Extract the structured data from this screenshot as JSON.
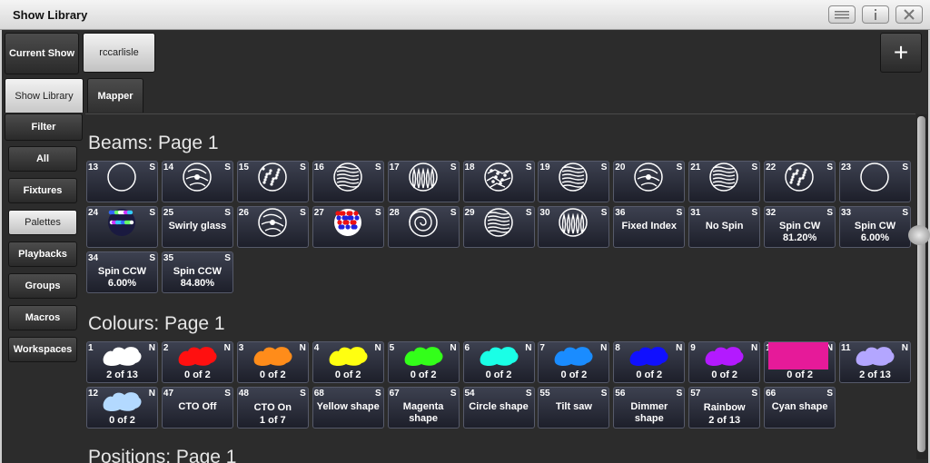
{
  "window": {
    "title": "Show Library"
  },
  "toolbar": {
    "current_show_label": "Current Show",
    "show_name": "rccarlisle",
    "add_symbol": "+"
  },
  "tabs": [
    {
      "label": "Show Library",
      "selected": true
    },
    {
      "label": "Mapper",
      "selected": false
    }
  ],
  "sidebar": {
    "filter_label": "Filter",
    "items": [
      {
        "label": "All",
        "selected": false
      },
      {
        "label": "Fixtures",
        "selected": false
      },
      {
        "label": "Palettes",
        "selected": true
      },
      {
        "label": "Playbacks",
        "selected": false
      },
      {
        "label": "Groups",
        "selected": false
      },
      {
        "label": "Macros",
        "selected": false
      },
      {
        "label": "Workspaces",
        "selected": false
      }
    ]
  },
  "sections": [
    {
      "title": "Beams: Page 1",
      "tiles": [
        {
          "num": "13",
          "flag": "S",
          "icon": "gobo-open-circle-icon"
        },
        {
          "num": "14",
          "flag": "S",
          "icon": "gobo-swirl-icon"
        },
        {
          "num": "15",
          "flag": "S",
          "icon": "gobo-dots-icon"
        },
        {
          "num": "16",
          "flag": "S",
          "icon": "gobo-lines-icon"
        },
        {
          "num": "17",
          "flag": "S",
          "icon": "gobo-flames-icon"
        },
        {
          "num": "18",
          "flag": "S",
          "icon": "gobo-shatter-icon"
        },
        {
          "num": "19",
          "flag": "S",
          "icon": "gobo-lines-icon"
        },
        {
          "num": "20",
          "flag": "S",
          "icon": "gobo-swirl-icon"
        },
        {
          "num": "21",
          "flag": "S",
          "icon": "gobo-lines-icon"
        },
        {
          "num": "22",
          "flag": "S",
          "icon": "gobo-dots-icon"
        },
        {
          "num": "23",
          "flag": "S",
          "icon": "gobo-open-circle-icon"
        },
        {
          "num": "24",
          "flag": "S",
          "icon": "gobo-colour-glass-icon"
        },
        {
          "num": "25",
          "flag": "S",
          "label": "Swirly glass"
        },
        {
          "num": "26",
          "flag": "S",
          "icon": "gobo-swirl-icon"
        },
        {
          "num": "27",
          "flag": "S",
          "icon": "gobo-colour-dots-icon"
        },
        {
          "num": "28",
          "flag": "S",
          "icon": "gobo-spiral-icon"
        },
        {
          "num": "29",
          "flag": "S",
          "icon": "gobo-lines-icon"
        },
        {
          "num": "30",
          "flag": "S",
          "icon": "gobo-flames-icon"
        },
        {
          "num": "36",
          "flag": "S",
          "label": "Fixed Index"
        },
        {
          "num": "31",
          "flag": "S",
          "label": "No Spin"
        },
        {
          "num": "32",
          "flag": "S",
          "label": "Spin CW 81.20%"
        },
        {
          "num": "33",
          "flag": "S",
          "label": "Spin CW 6.00%"
        },
        {
          "num": "34",
          "flag": "S",
          "label": "Spin CCW 6.00%"
        },
        {
          "num": "35",
          "flag": "S",
          "label": "Spin CCW 84.80%"
        }
      ]
    },
    {
      "title": "Colours: Page 1",
      "tiles": [
        {
          "num": "1",
          "flag": "N",
          "color": "#ffffff",
          "sub": "2 of 13"
        },
        {
          "num": "2",
          "flag": "N",
          "color": "#ff1010",
          "sub": "0 of 2"
        },
        {
          "num": "3",
          "flag": "N",
          "color": "#ff8c1a",
          "sub": "0 of 2"
        },
        {
          "num": "4",
          "flag": "N",
          "color": "#ffff10",
          "sub": "0 of 2"
        },
        {
          "num": "5",
          "flag": "N",
          "color": "#33ff1a",
          "sub": "0 of 2"
        },
        {
          "num": "6",
          "flag": "N",
          "color": "#1affe6",
          "sub": "0 of 2"
        },
        {
          "num": "7",
          "flag": "N",
          "color": "#1a8cff",
          "sub": "0 of 2"
        },
        {
          "num": "8",
          "flag": "N",
          "color": "#1010ff",
          "sub": "0 of 2"
        },
        {
          "num": "9",
          "flag": "N",
          "color": "#b31aff",
          "sub": "0 of 2"
        },
        {
          "num": "10",
          "flag": "N",
          "color": "#e61a99",
          "sub": "0 of 2",
          "solid": true
        },
        {
          "num": "11",
          "flag": "N",
          "color": "#b3a6ff",
          "sub": "2 of 13"
        },
        {
          "num": "12",
          "flag": "N",
          "color": "#b3d9ff",
          "sub": "0 of 2"
        },
        {
          "num": "47",
          "flag": "S",
          "label": "CTO Off"
        },
        {
          "num": "48",
          "flag": "S",
          "label": "CTO On",
          "sub": "1 of 7"
        },
        {
          "num": "68",
          "flag": "S",
          "label": "Yellow shape"
        },
        {
          "num": "67",
          "flag": "S",
          "label": "Magenta shape"
        },
        {
          "num": "54",
          "flag": "S",
          "label": "Circle shape"
        },
        {
          "num": "55",
          "flag": "S",
          "label": "Tilt saw"
        },
        {
          "num": "56",
          "flag": "S",
          "label": "Dimmer shape"
        },
        {
          "num": "57",
          "flag": "S",
          "label": "Rainbow",
          "sub": "2 of 13"
        },
        {
          "num": "66",
          "flag": "S",
          "label": "Cyan shape"
        }
      ]
    },
    {
      "title": "Positions: Page 1",
      "tiles": []
    }
  ]
}
